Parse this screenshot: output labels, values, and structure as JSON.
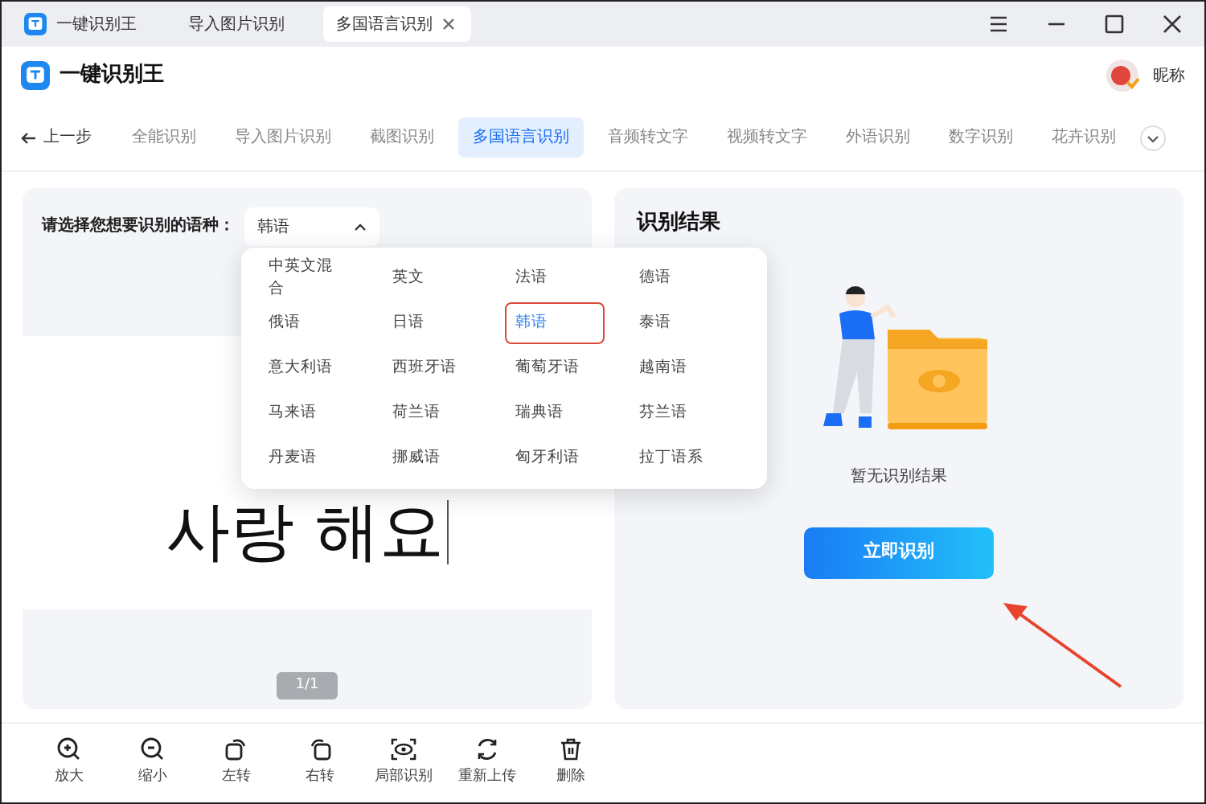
{
  "window": {
    "tabs": [
      {
        "label": "一键识别王",
        "selected": false
      },
      {
        "label": "导入图片识别",
        "selected": false
      },
      {
        "label": "多国语言识别",
        "selected": true
      }
    ]
  },
  "header": {
    "app_name": "一键识别王",
    "user_name": "昵称"
  },
  "nav": {
    "back": "上一步",
    "tabs": [
      {
        "label": "全能识别",
        "selected": false
      },
      {
        "label": "导入图片识别",
        "selected": false
      },
      {
        "label": "截图识别",
        "selected": false
      },
      {
        "label": "多国语言识别",
        "selected": true
      },
      {
        "label": "音频转文字",
        "selected": false
      },
      {
        "label": "视频转文字",
        "selected": false
      },
      {
        "label": "外语识别",
        "selected": false
      },
      {
        "label": "数字识别",
        "selected": false
      },
      {
        "label": "花卉识别",
        "selected": false
      }
    ]
  },
  "language_select": {
    "label": "请选择您想要识别的语种：",
    "value": "韩语",
    "expanded": true,
    "options": [
      {
        "label": "中英文混合",
        "selected": false
      },
      {
        "label": "英文",
        "selected": false
      },
      {
        "label": "法语",
        "selected": false
      },
      {
        "label": "德语",
        "selected": false
      },
      {
        "label": "俄语",
        "selected": false
      },
      {
        "label": "日语",
        "selected": false
      },
      {
        "label": "韩语",
        "selected": true
      },
      {
        "label": "泰语",
        "selected": false
      },
      {
        "label": "意大利语",
        "selected": false
      },
      {
        "label": "西班牙语",
        "selected": false
      },
      {
        "label": "葡萄牙语",
        "selected": false
      },
      {
        "label": "越南语",
        "selected": false
      },
      {
        "label": "马来语",
        "selected": false
      },
      {
        "label": "荷兰语",
        "selected": false
      },
      {
        "label": "瑞典语",
        "selected": false
      },
      {
        "label": "芬兰语",
        "selected": false
      },
      {
        "label": "丹麦语",
        "selected": false
      },
      {
        "label": "挪威语",
        "selected": false
      },
      {
        "label": "匈牙利语",
        "selected": false
      },
      {
        "label": "拉丁语系",
        "selected": false
      }
    ]
  },
  "image_preview": {
    "text": "사랑 해요",
    "page": "1/1"
  },
  "result": {
    "title": "识别结果",
    "empty_text": "暂无识别结果",
    "button": "立即识别"
  },
  "toolbar": [
    "放大",
    "缩小",
    "左转",
    "右转",
    "局部识别",
    "重新上传",
    "删除"
  ]
}
